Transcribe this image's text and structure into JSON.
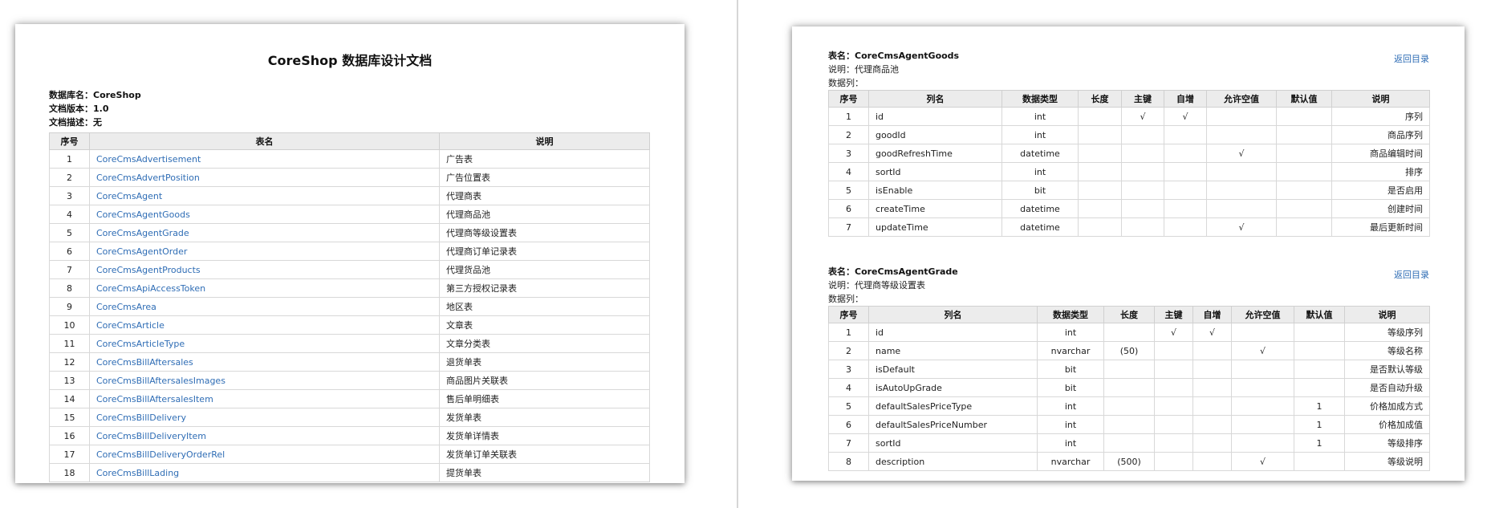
{
  "left_page": {
    "title": "CoreShop 数据库设计文档",
    "meta": {
      "db_name_label": "数据库名：",
      "db_name_value": "CoreShop",
      "version_label": "文档版本：",
      "version_value": "1.0",
      "desc_label": "文档描述：",
      "desc_value": "无"
    },
    "index_headers": [
      "序号",
      "表名",
      "说明"
    ],
    "index_rows": [
      {
        "no": "1",
        "name": "CoreCmsAdvertisement",
        "desc": "广告表"
      },
      {
        "no": "2",
        "name": "CoreCmsAdvertPosition",
        "desc": "广告位置表"
      },
      {
        "no": "3",
        "name": "CoreCmsAgent",
        "desc": "代理商表"
      },
      {
        "no": "4",
        "name": "CoreCmsAgentGoods",
        "desc": "代理商品池"
      },
      {
        "no": "5",
        "name": "CoreCmsAgentGrade",
        "desc": "代理商等级设置表"
      },
      {
        "no": "6",
        "name": "CoreCmsAgentOrder",
        "desc": "代理商订单记录表"
      },
      {
        "no": "7",
        "name": "CoreCmsAgentProducts",
        "desc": "代理货品池"
      },
      {
        "no": "8",
        "name": "CoreCmsApiAccessToken",
        "desc": "第三方授权记录表"
      },
      {
        "no": "9",
        "name": "CoreCmsArea",
        "desc": "地区表"
      },
      {
        "no": "10",
        "name": "CoreCmsArticle",
        "desc": "文章表"
      },
      {
        "no": "11",
        "name": "CoreCmsArticleType",
        "desc": "文章分类表"
      },
      {
        "no": "12",
        "name": "CoreCmsBillAftersales",
        "desc": "退货单表"
      },
      {
        "no": "13",
        "name": "CoreCmsBillAftersalesImages",
        "desc": "商品图片关联表"
      },
      {
        "no": "14",
        "name": "CoreCmsBillAftersalesItem",
        "desc": "售后单明细表"
      },
      {
        "no": "15",
        "name": "CoreCmsBillDelivery",
        "desc": "发货单表"
      },
      {
        "no": "16",
        "name": "CoreCmsBillDeliveryItem",
        "desc": "发货单详情表"
      },
      {
        "no": "17",
        "name": "CoreCmsBillDeliveryOrderRel",
        "desc": "发货单订单关联表"
      },
      {
        "no": "18",
        "name": "CoreCmsBillLading",
        "desc": "提货单表"
      }
    ]
  },
  "right_page": {
    "back_link_label": "返回目录",
    "column_headers": [
      "序号",
      "列名",
      "数据类型",
      "长度",
      "主键",
      "自增",
      "允许空值",
      "默认值",
      "说明"
    ],
    "tables": [
      {
        "name_label": "表名：",
        "name": "CoreCmsAgentGoods",
        "desc_label": "说明：",
        "desc": "代理商品池",
        "cols_label": "数据列：",
        "rows": [
          {
            "no": "1",
            "col": "id",
            "type": "int",
            "len": "",
            "pk": "√",
            "ai": "√",
            "nullable": "",
            "default": "",
            "desc": "序列"
          },
          {
            "no": "2",
            "col": "goodId",
            "type": "int",
            "len": "",
            "pk": "",
            "ai": "",
            "nullable": "",
            "default": "",
            "desc": "商品序列"
          },
          {
            "no": "3",
            "col": "goodRefreshTime",
            "type": "datetime",
            "len": "",
            "pk": "",
            "ai": "",
            "nullable": "√",
            "default": "",
            "desc": "商品编辑时间"
          },
          {
            "no": "4",
            "col": "sortId",
            "type": "int",
            "len": "",
            "pk": "",
            "ai": "",
            "nullable": "",
            "default": "",
            "desc": "排序"
          },
          {
            "no": "5",
            "col": "isEnable",
            "type": "bit",
            "len": "",
            "pk": "",
            "ai": "",
            "nullable": "",
            "default": "",
            "desc": "是否启用"
          },
          {
            "no": "6",
            "col": "createTime",
            "type": "datetime",
            "len": "",
            "pk": "",
            "ai": "",
            "nullable": "",
            "default": "",
            "desc": "创建时间"
          },
          {
            "no": "7",
            "col": "updateTime",
            "type": "datetime",
            "len": "",
            "pk": "",
            "ai": "",
            "nullable": "√",
            "default": "",
            "desc": "最后更新时间"
          }
        ]
      },
      {
        "name_label": "表名：",
        "name": "CoreCmsAgentGrade",
        "desc_label": "说明：",
        "desc": "代理商等级设置表",
        "cols_label": "数据列：",
        "rows": [
          {
            "no": "1",
            "col": "id",
            "type": "int",
            "len": "",
            "pk": "√",
            "ai": "√",
            "nullable": "",
            "default": "",
            "desc": "等级序列"
          },
          {
            "no": "2",
            "col": "name",
            "type": "nvarchar",
            "len": "(50)",
            "pk": "",
            "ai": "",
            "nullable": "√",
            "default": "",
            "desc": "等级名称"
          },
          {
            "no": "3",
            "col": "isDefault",
            "type": "bit",
            "len": "",
            "pk": "",
            "ai": "",
            "nullable": "",
            "default": "",
            "desc": "是否默认等级"
          },
          {
            "no": "4",
            "col": "isAutoUpGrade",
            "type": "bit",
            "len": "",
            "pk": "",
            "ai": "",
            "nullable": "",
            "default": "",
            "desc": "是否自动升级"
          },
          {
            "no": "5",
            "col": "defaultSalesPriceType",
            "type": "int",
            "len": "",
            "pk": "",
            "ai": "",
            "nullable": "",
            "default": "1",
            "desc": "价格加成方式"
          },
          {
            "no": "6",
            "col": "defaultSalesPriceNumber",
            "type": "int",
            "len": "",
            "pk": "",
            "ai": "",
            "nullable": "",
            "default": "1",
            "desc": "价格加成值"
          },
          {
            "no": "7",
            "col": "sortId",
            "type": "int",
            "len": "",
            "pk": "",
            "ai": "",
            "nullable": "",
            "default": "1",
            "desc": "等级排序"
          },
          {
            "no": "8",
            "col": "description",
            "type": "nvarchar",
            "len": "(500)",
            "pk": "",
            "ai": "",
            "nullable": "√",
            "default": "",
            "desc": "等级说明"
          }
        ]
      }
    ]
  }
}
